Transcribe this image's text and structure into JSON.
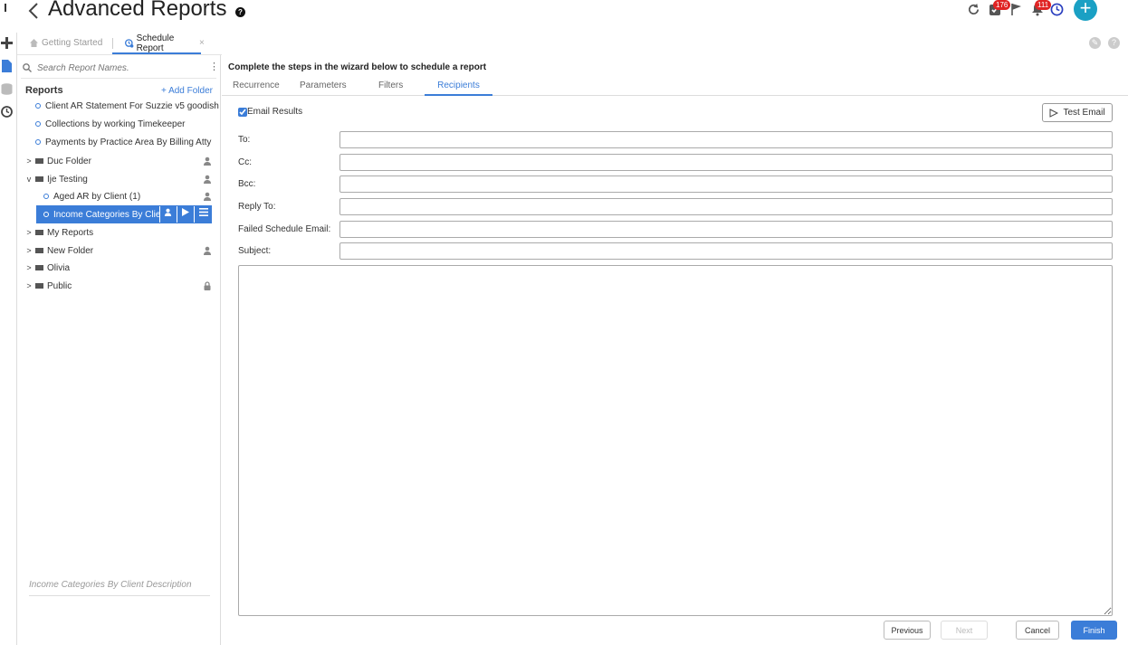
{
  "header": {
    "title": "Advanced Reports",
    "help": "?",
    "tasks_count": "176",
    "notifications_count": "111",
    "add": "+"
  },
  "tabs": {
    "getting_started": "Getting Started",
    "schedule_report": "Schedule Report",
    "close": "×"
  },
  "sidebar": {
    "search_placeholder": "Search Report Names.",
    "reports_heading": "Reports",
    "add_folder": "+ Add Folder",
    "items": [
      {
        "label": "Client AR Statement For Suzzie v5 goodish",
        "kind": "report"
      },
      {
        "label": "Collections by working Timekeeper",
        "kind": "report"
      },
      {
        "label": "Payments by Practice Area By Billing Atty",
        "kind": "report"
      },
      {
        "label": "Duc Folder",
        "kind": "folder"
      },
      {
        "label": "Ije Testing",
        "kind": "folder"
      },
      {
        "label": "Aged AR by Client (1)",
        "kind": "report"
      },
      {
        "label": "Income Categories By Client",
        "kind": "report"
      },
      {
        "label": "My Reports",
        "kind": "folder"
      },
      {
        "label": "New Folder",
        "kind": "folder"
      },
      {
        "label": "Olivia",
        "kind": "folder"
      },
      {
        "label": "Public",
        "kind": "folder"
      }
    ],
    "description_placeholder": "Income Categories By Client Description"
  },
  "wizard": {
    "title": "Complete the steps in the wizard below to schedule a report",
    "tabs": [
      "Recurrence",
      "Parameters",
      "Filters",
      "Recipients"
    ],
    "active_tab": "Recipients"
  },
  "recipients": {
    "email_results_label": "Email Results",
    "email_results_checked": true,
    "test_email": "Test Email",
    "fields": {
      "to": "To:",
      "cc": "Cc:",
      "bcc": "Bcc:",
      "reply_to": "Reply To:",
      "failed_schedule_email": "Failed Schedule Email:",
      "subject": "Subject:"
    }
  },
  "footer": {
    "previous": "Previous",
    "next": "Next",
    "cancel": "Cancel",
    "finish": "Finish"
  },
  "colors": {
    "accent": "#3b7dd8",
    "badge": "#e02424",
    "add_button": "#1aa0c4"
  }
}
